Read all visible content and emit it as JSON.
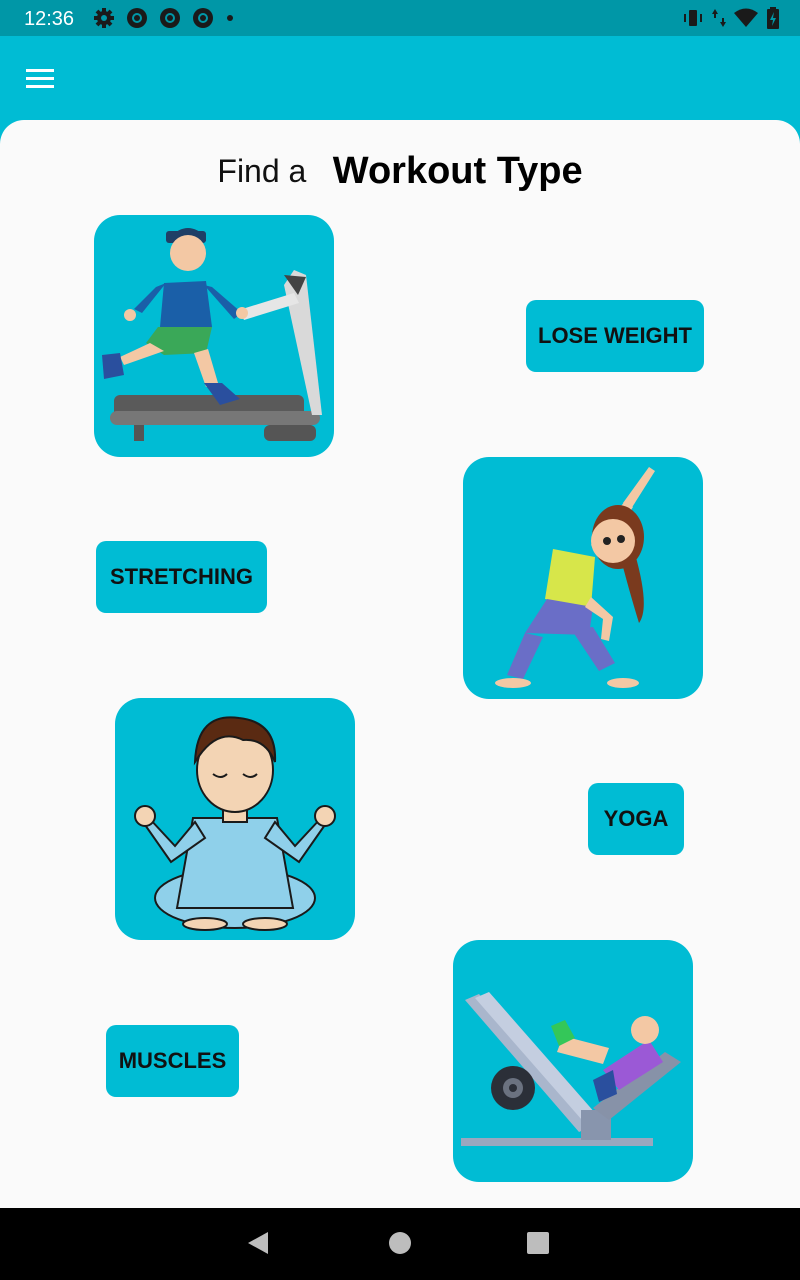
{
  "status_bar": {
    "time": "12:36",
    "left_icons": [
      "gear-icon",
      "chrome-icon",
      "chrome-icon",
      "chrome-icon",
      "dot-icon"
    ],
    "right_icons": [
      "vibrate-icon",
      "data-arrows-icon",
      "wifi-icon",
      "battery-icon"
    ]
  },
  "app_bar": {
    "menu_icon": "hamburger-menu-icon"
  },
  "heading": {
    "prefix": "Find a",
    "title": "Workout Type"
  },
  "workouts": [
    {
      "label": "LOSE WEIGHT",
      "image": "treadmill-runner-illustration"
    },
    {
      "label": "STRETCHING",
      "image": "side-stretch-girl-illustration"
    },
    {
      "label": "YOGA",
      "image": "meditating-man-illustration"
    },
    {
      "label": "MUSCLES",
      "image": "leg-press-machine-illustration"
    }
  ],
  "nav_bar": {
    "buttons": [
      "back-icon",
      "home-icon",
      "recents-icon"
    ]
  },
  "colors": {
    "primary": "#00BCD4",
    "status_bar": "#0097A7",
    "card": "#FAFAFA",
    "nav_bar": "#000000"
  }
}
